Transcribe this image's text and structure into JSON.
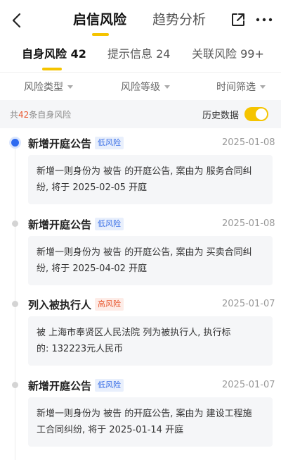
{
  "nav": {
    "tabs": [
      {
        "label": "启信风险"
      },
      {
        "label": "趋势分析"
      }
    ],
    "icons": {
      "back": "back-icon",
      "share": "share-icon",
      "more": "more-icon"
    }
  },
  "subtabs": [
    {
      "label": "自身风险 42"
    },
    {
      "label": "提示信息 24"
    },
    {
      "label": "关联风险 99+"
    }
  ],
  "filters": [
    {
      "label": "风险类型"
    },
    {
      "label": "风险等级"
    },
    {
      "label": "时间筛选"
    }
  ],
  "summary": {
    "prefix": "共",
    "count": "42",
    "suffix": "条自身风险",
    "history_label": "历史数据",
    "history_on": true
  },
  "colors": {
    "accent": "#f5c400",
    "low_risk": "#3b70e6",
    "high_risk": "#e8572f",
    "timeline_active": "#2f6bf0"
  },
  "items": [
    {
      "title": "新增开庭公告",
      "badge": "低风险",
      "level": "low",
      "date": "2025-01-08",
      "line1": "新增一则身份为 被告 的开庭公告, 案由为 服务合同纠",
      "line2": "纷, 将于 2025-02-05 开庭"
    },
    {
      "title": "新增开庭公告",
      "badge": "低风险",
      "level": "low",
      "date": "2025-01-08",
      "line1": "新增一则身份为 被告 的开庭公告, 案由为 买卖合同纠",
      "line2": "纷, 将于 2025-04-02 开庭"
    },
    {
      "title": "列入被执行人",
      "badge": "高风险",
      "level": "high",
      "date": "2025-01-07",
      "line1": "被 上海市奉贤区人民法院 列为被执行人, 执行标",
      "line2": "的: 132223元人民币"
    },
    {
      "title": "新增开庭公告",
      "badge": "低风险",
      "level": "low",
      "date": "2025-01-07",
      "line1": "新增一则身份为 被告 的开庭公告, 案由为 建设工程施",
      "line2": "工合同纠纷, 将于 2025-01-14 开庭"
    }
  ]
}
